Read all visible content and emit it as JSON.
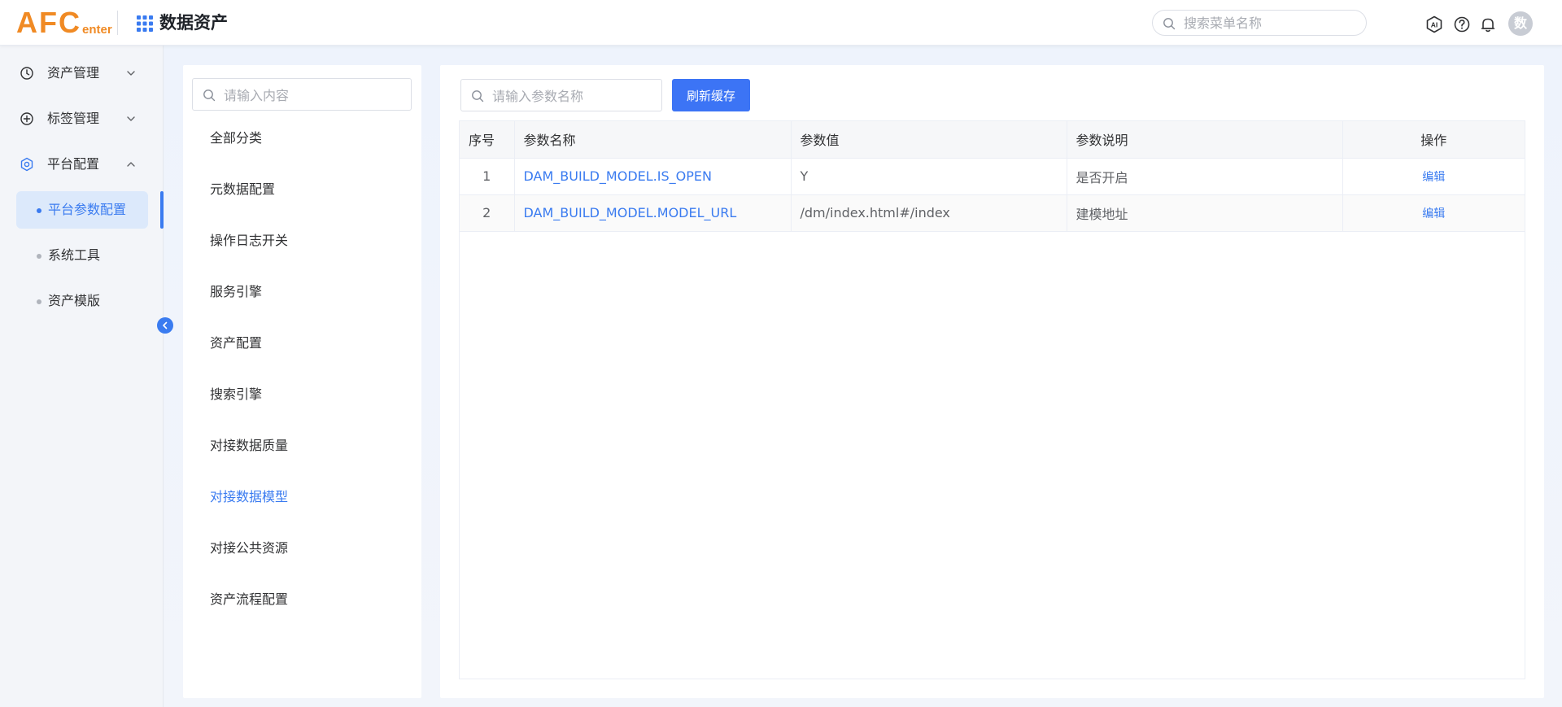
{
  "header": {
    "logo_main": "AFC",
    "logo_sub": "enter",
    "app_title": "数据资产",
    "menu_search_placeholder": "搜索菜单名称",
    "avatar_text": "数"
  },
  "colors": {
    "primary": "#3a7bf0",
    "logo": "#f08a24"
  },
  "sidebar": {
    "groups": [
      {
        "label": "资产管理",
        "icon": "clock-icon",
        "expanded": false
      },
      {
        "label": "标签管理",
        "icon": "plus-circle-icon",
        "expanded": false
      },
      {
        "label": "平台配置",
        "icon": "gear-icon",
        "expanded": true
      }
    ],
    "sub_items": [
      {
        "label": "平台参数配置",
        "active": true
      },
      {
        "label": "系统工具",
        "active": false
      },
      {
        "label": "资产模版",
        "active": false
      }
    ]
  },
  "categories": {
    "search_placeholder": "请输入内容",
    "items": [
      {
        "label": "全部分类",
        "active": false
      },
      {
        "label": "元数据配置",
        "active": false
      },
      {
        "label": "操作日志开关",
        "active": false
      },
      {
        "label": "服务引擎",
        "active": false
      },
      {
        "label": "资产配置",
        "active": false
      },
      {
        "label": "搜索引擎",
        "active": false
      },
      {
        "label": "对接数据质量",
        "active": false
      },
      {
        "label": "对接数据模型",
        "active": true
      },
      {
        "label": "对接公共资源",
        "active": false
      },
      {
        "label": "资产流程配置",
        "active": false
      }
    ]
  },
  "params": {
    "search_placeholder": "请输入参数名称",
    "refresh_label": "刷新缓存",
    "columns": [
      "序号",
      "参数名称",
      "参数值",
      "参数说明",
      "操作"
    ],
    "rows": [
      {
        "index": "1",
        "name": "DAM_BUILD_MODEL.IS_OPEN",
        "value": "Y",
        "desc": "是否开启",
        "action": "编辑"
      },
      {
        "index": "2",
        "name": "DAM_BUILD_MODEL.MODEL_URL",
        "value": "/dm/index.html#/index",
        "desc": "建模地址",
        "action": "编辑"
      }
    ]
  }
}
